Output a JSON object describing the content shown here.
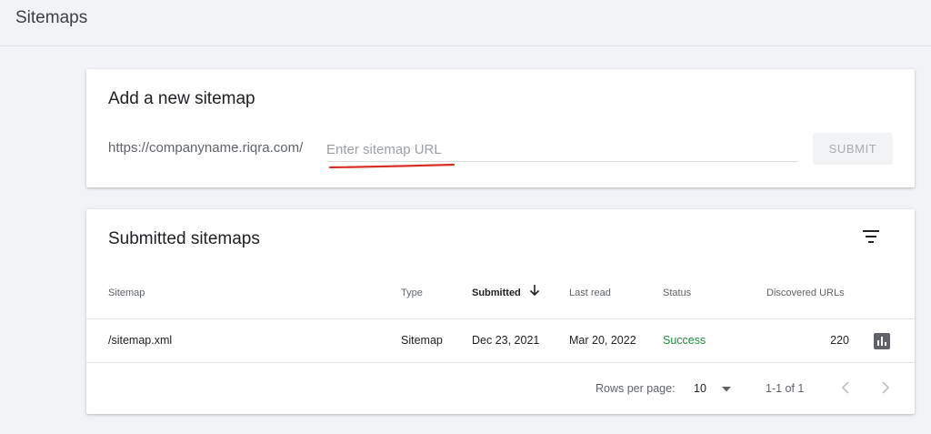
{
  "page": {
    "title": "Sitemaps"
  },
  "add_sitemap": {
    "title": "Add a new sitemap",
    "url_prefix": "https://companyname.riqra.com/",
    "input_value": "",
    "input_placeholder": "Enter sitemap URL",
    "submit_label": "SUBMIT",
    "annotation_color": "#d93025"
  },
  "submitted": {
    "title": "Submitted sitemaps",
    "columns": {
      "sitemap": "Sitemap",
      "type": "Type",
      "submitted": "Submitted",
      "last_read": "Last read",
      "status": "Status",
      "discovered": "Discovered URLs"
    },
    "sort_column": "submitted",
    "sort_direction": "descending",
    "rows": [
      {
        "sitemap": "/sitemap.xml",
        "type": "Sitemap",
        "submitted": "Dec 23, 2021",
        "last_read": "Mar 20, 2022",
        "status": "Success",
        "discovered": "220"
      }
    ],
    "footer": {
      "rows_per_page_label": "Rows per page:",
      "rows_per_page_value": "10",
      "range": "1-1 of 1"
    }
  },
  "icons": {
    "filter": "filter-icon",
    "sort": "arrow-down-icon",
    "report": "bar-chart-icon",
    "dropdown": "triangle-down-icon",
    "prev": "chevron-left-icon",
    "next": "chevron-right-icon"
  },
  "colors": {
    "success": "#1e8e3e",
    "background": "#f1f3f7"
  }
}
